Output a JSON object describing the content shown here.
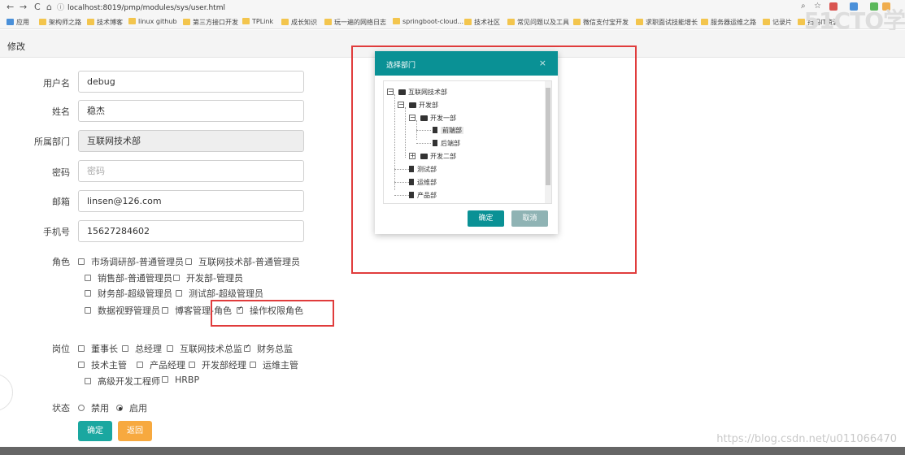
{
  "browser": {
    "url": "localhost:8019/pmp/modules/sys/user.html",
    "bookmarks": [
      "应用",
      "架构师之路",
      "技术博客",
      "linux github",
      "第三方接口开发",
      "TPLink",
      "成长知识",
      "玩一遍的网络日志",
      "springboot-cloud...",
      "技术社区",
      "常见问题以及工具",
      "微信支付宝开发",
      "求职面试技能增长",
      "服务器运维之路",
      "记录片",
      "扫码IT资源"
    ],
    "watermark": "51CTO学",
    "colors": {
      "bookmark_folder": "#f3c54d"
    }
  },
  "page": {
    "title": "修改"
  },
  "form": {
    "username": {
      "label": "用户名",
      "value": "debug"
    },
    "name": {
      "label": "姓名",
      "value": "稳杰"
    },
    "dept": {
      "label": "所属部门",
      "value": "互联网技术部"
    },
    "password": {
      "label": "密码",
      "placeholder": "密码"
    },
    "email": {
      "label": "邮箱",
      "value": "linsen@126.com"
    },
    "phone": {
      "label": "手机号",
      "value": "15627284602"
    },
    "roles": {
      "label": "角色",
      "items": [
        {
          "text": "市场调研部-普通管理员",
          "checked": false
        },
        {
          "text": "互联网技术部-普通管理员",
          "checked": false
        },
        {
          "text": "销售部-普通管理员",
          "checked": false
        },
        {
          "text": "开发部-管理员",
          "checked": false
        },
        {
          "text": "财务部-超级管理员",
          "checked": false
        },
        {
          "text": "测试部-超级管理员",
          "checked": false
        },
        {
          "text": "数据视野管理员",
          "checked": false
        },
        {
          "text": "博客管理-角色",
          "checked": false
        },
        {
          "text": "操作权限角色",
          "checked": true
        }
      ]
    },
    "posts": {
      "label": "岗位",
      "items": [
        {
          "text": "董事长",
          "checked": false
        },
        {
          "text": "总经理",
          "checked": false
        },
        {
          "text": "互联网技术总监",
          "checked": false
        },
        {
          "text": "财务总监",
          "checked": true
        },
        {
          "text": "技术主管",
          "checked": false
        },
        {
          "text": "产品经理",
          "checked": false
        },
        {
          "text": "开发部经理",
          "checked": false
        },
        {
          "text": "运维主管",
          "checked": false
        },
        {
          "text": "高级开发工程师",
          "checked": false
        },
        {
          "text": "HRBP",
          "checked": false
        }
      ]
    },
    "status": {
      "label": "状态",
      "options": [
        {
          "text": "禁用",
          "checked": false
        },
        {
          "text": "启用",
          "checked": true
        }
      ]
    },
    "ok_label": "确定",
    "back_label": "返回",
    "colors": {
      "ok": "#1aa7a0",
      "back": "#f7a93f",
      "highlight_box": "#e03c3c"
    }
  },
  "dialog": {
    "title": "选择部门",
    "close": "×",
    "tree": {
      "root": "互联网技术部",
      "dev": "开发部",
      "dev1": "开发一部",
      "leaf1": "前端部",
      "leaf2": "后端部",
      "dev2": "开发二部",
      "test": "测试部",
      "ops": "运维部",
      "product": "产品部"
    },
    "ok_label": "确定",
    "cancel_label": "取消",
    "colors": {
      "header": "#0a9195",
      "ok": "#0a9195",
      "cancel": "#8fb3b4"
    }
  },
  "footer": {
    "watermark_url": "https://blog.csdn.net/u011066470"
  }
}
